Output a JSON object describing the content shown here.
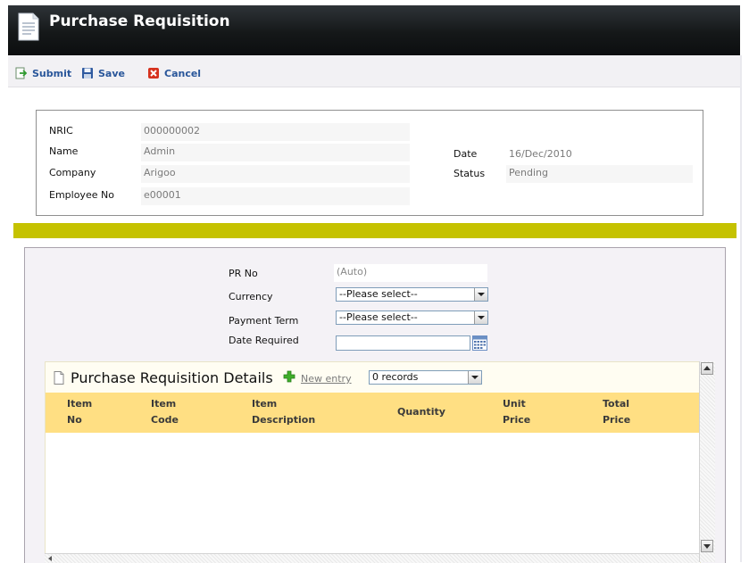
{
  "window": {
    "title": "Purchase Requisition"
  },
  "toolbar": {
    "submit_label": "Submit",
    "save_label": "Save",
    "cancel_label": "Cancel"
  },
  "employee": {
    "nric_label": "NRIC",
    "nric_value": "000000002",
    "name_label": "Name",
    "name_value": "Admin",
    "company_label": "Company",
    "company_value": "Arigoo",
    "employee_no_label": "Employee No",
    "employee_no_value": "e00001",
    "date_label": "Date",
    "date_value": "16/Dec/2010",
    "status_label": "Status",
    "status_value": "Pending"
  },
  "form": {
    "pr_no_label": "PR No",
    "pr_no_value": "(Auto)",
    "currency_label": "Currency",
    "currency_value": "--Please select--",
    "payment_term_label": "Payment Term",
    "payment_term_value": "--Please select--",
    "date_required_label": "Date Required",
    "date_required_value": ""
  },
  "details": {
    "title": "Purchase Requisition Details",
    "new_entry_label": "New entry",
    "records_value": "0 records",
    "columns": [
      {
        "line1": "Item",
        "line2": "No"
      },
      {
        "line1": "Item",
        "line2": "Code"
      },
      {
        "line1": "Item",
        "line2": "Description"
      },
      {
        "line1": "Quantity",
        "line2": ""
      },
      {
        "line1": "Unit",
        "line2": "Price"
      },
      {
        "line1": "Total",
        "line2": "Price"
      }
    ]
  },
  "colors": {
    "accent_bar": "#c5c200",
    "header_row": "#ffdf83",
    "link_blue": "#29569a"
  },
  "icons": {
    "title": "document-icon",
    "submit": "submit-icon",
    "save": "floppy-disk-icon",
    "cancel": "cancel-icon",
    "calendar": "calendar-icon",
    "details": "document-icon",
    "add": "plus-icon"
  }
}
